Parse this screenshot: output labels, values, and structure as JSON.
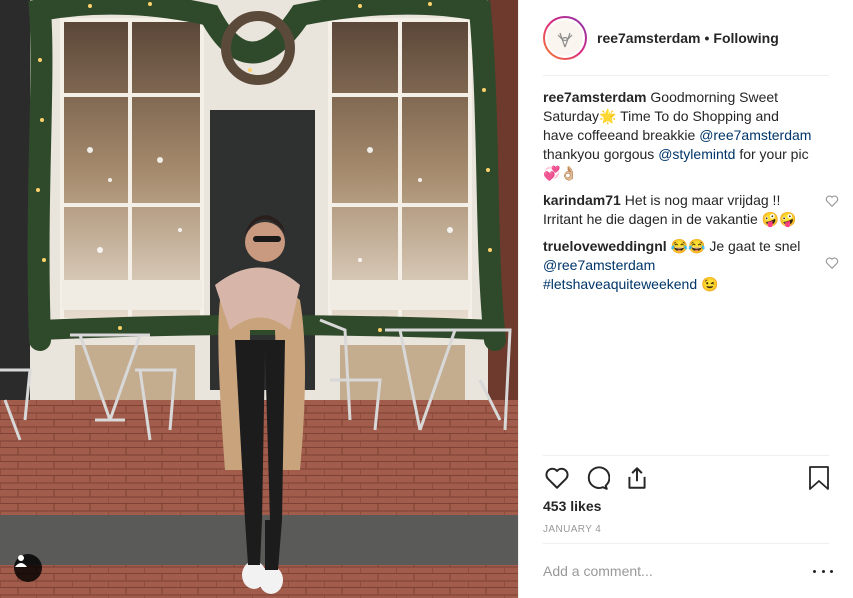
{
  "post": {
    "username": "ree7amsterdam",
    "separator": "•",
    "follow_status": "Following"
  },
  "comments": [
    {
      "user": "ree7amsterdam",
      "parts": [
        {
          "text": " Goodmorning Sweet Saturday🌟 Time To do Shopping and have coffeeand breakkie "
        },
        {
          "mention": "@ree7amsterdam"
        },
        {
          "text": " thankyou gorgous "
        },
        {
          "mention": "@stylemintd"
        },
        {
          "text": " for your pic 💞👌🏼"
        }
      ]
    },
    {
      "user": "karindam71",
      "parts": [
        {
          "text": " Het is nog maar vrijdag !! Irritant he die dagen in de vakantie 🤪🤪"
        }
      ]
    },
    {
      "user": "trueloveweddingnl",
      "parts": [
        {
          "text": " 😂😂 Je gaat te snel "
        },
        {
          "mention": "@ree7amsterdam"
        },
        {
          "text": " "
        },
        {
          "mention": "#letshaveaquiteweekend"
        },
        {
          "text": " 😉"
        }
      ]
    }
  ],
  "likes": "453 likes",
  "date": "JANUARY 4",
  "add_comment": {
    "placeholder": "Add a comment..."
  },
  "icons": {
    "like": "heart-icon",
    "comment": "comment-bubble-icon",
    "share": "share-icon",
    "save": "bookmark-icon",
    "more": "more-options-icon",
    "tag": "user-tag-icon",
    "avatar": "deer-logo"
  },
  "colors": {
    "mention": "#003569",
    "secondary_text": "#999999",
    "border": "#efefef"
  }
}
